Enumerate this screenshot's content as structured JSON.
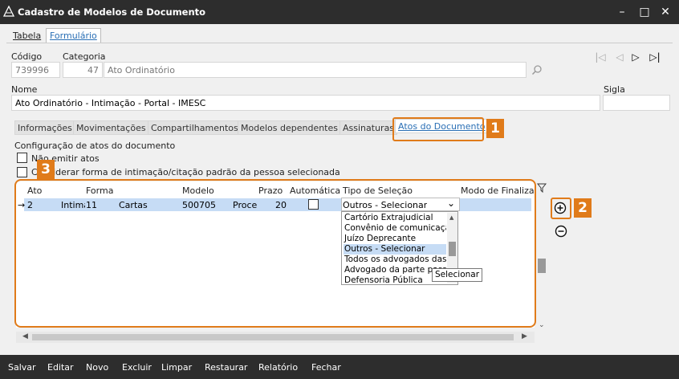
{
  "window": {
    "title": "Cadastro de Modelos de Documento"
  },
  "top_tabs": [
    {
      "label": "Tabela"
    },
    {
      "label": "Formulário"
    }
  ],
  "fields": {
    "codigo_label": "Código",
    "codigo_value": "739996",
    "categoria_label": "Categoria",
    "categoria_id": "47",
    "categoria_name": "Ato Ordinatório",
    "nome_label": "Nome",
    "nome_value": "Ato Ordinatório - Intimação - Portal - IMESC",
    "sigla_label": "Sigla",
    "sigla_value": ""
  },
  "doc_tabs": [
    {
      "label": "Informações"
    },
    {
      "label": "Movimentações"
    },
    {
      "label": "Compartilhamentos"
    },
    {
      "label": "Modelos dependentes"
    },
    {
      "label": "Assinaturas"
    },
    {
      "label": "Atos do Documento"
    }
  ],
  "config": {
    "title": "Configuração de atos do documento",
    "opt1": "Não emitir atos",
    "opt2": "Considerar forma de intimação/citação padrão da pessoa selecionada"
  },
  "grid": {
    "columns": [
      "Ato",
      "Forma",
      "Modelo",
      "Prazo",
      "Automática",
      "Tipo de Seleção",
      "Modo de Finalização"
    ],
    "row": {
      "ato": "2",
      "forma_a": "Intimação",
      "forma_b": "11",
      "forma_c": "Cartas",
      "modelo": "500705",
      "proces": "Processo",
      "prazo": "20",
      "tipo": "Outros - Selecionar"
    },
    "dropdown_options": [
      "Cartório Extrajudicial",
      "Convênio de comunicação",
      "Juízo Deprecante",
      "Outros - Selecionar",
      "Todos os advogados das partes",
      "Advogado da parte passiva",
      "Defensoria Pública"
    ],
    "dropdown_selected_index": 3,
    "tooltip": "Selecionar"
  },
  "annotations": {
    "b1": "1",
    "b2": "2",
    "b3": "3"
  },
  "footer": [
    "Salvar",
    "Editar",
    "Novo",
    "Excluir",
    "Limpar",
    "Restaurar",
    "Relatório",
    "Fechar"
  ],
  "colors": {
    "accent": "#e07b1a",
    "titlebar": "#2d2d2d",
    "selection": "#c6dcf5",
    "link": "#2a6fb5"
  }
}
